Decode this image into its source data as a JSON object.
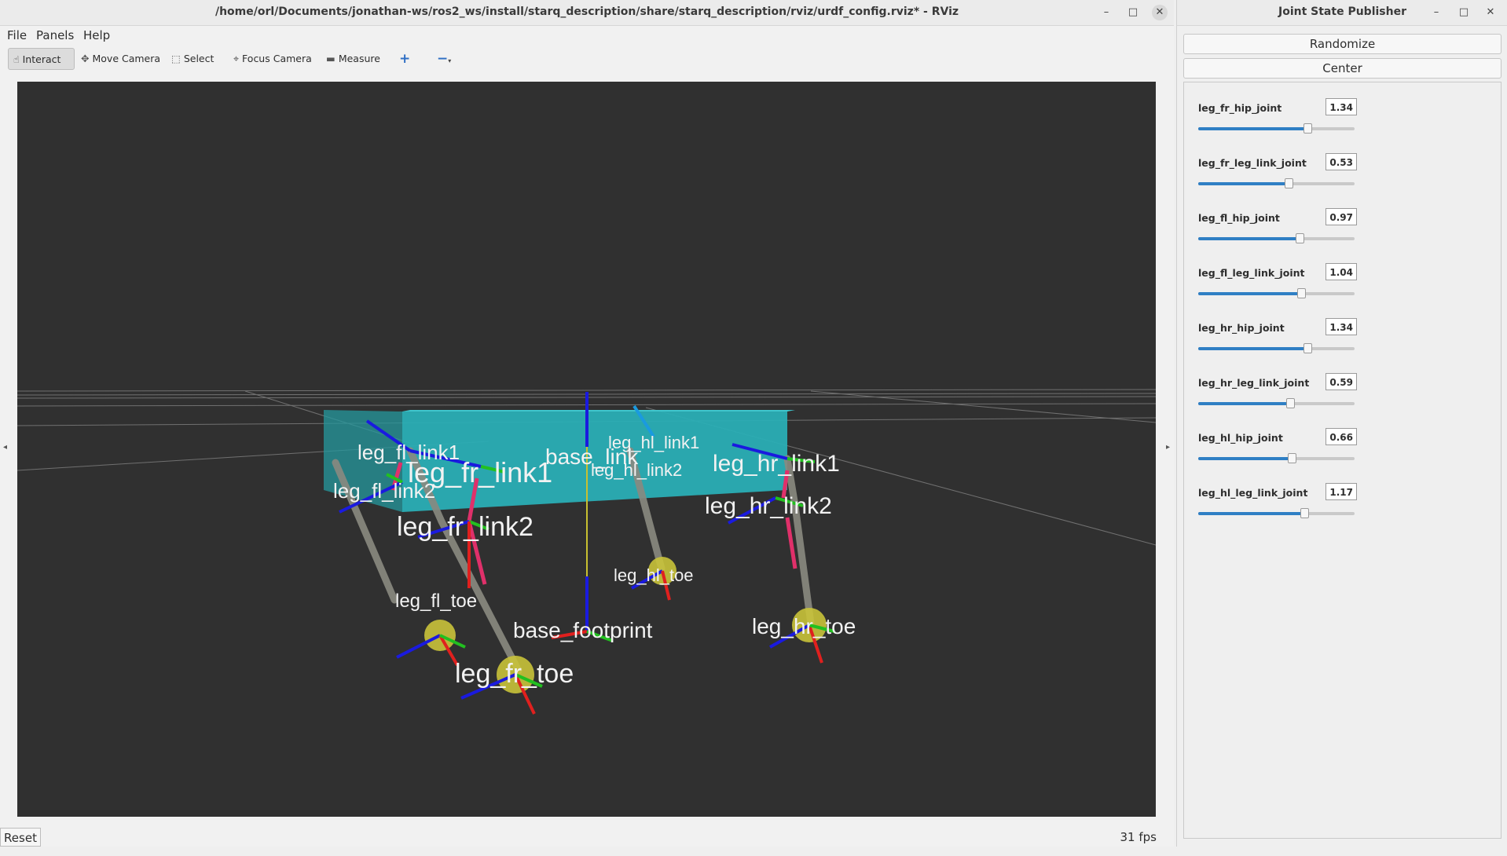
{
  "rviz": {
    "title": "/home/orl/Documents/jonathan-ws/ros2_ws/install/starq_description/share/starq_description/rviz/urdf_config.rviz* - RViz",
    "menu": [
      "File",
      "Panels",
      "Help"
    ],
    "toolbar": {
      "interact": "Interact",
      "move_camera": "Move Camera",
      "select": "Select",
      "focus_camera": "Focus Camera",
      "measure": "Measure",
      "add_icon": "plus-icon",
      "remove_icon": "minus-icon"
    },
    "frame_labels": {
      "leg_fr_link1_a": "leg_fr_link1",
      "leg_fl_link1": "leg_fl_link1",
      "base_link": "base_link",
      "leg_hl_link1": "leg_hl_link1",
      "leg_hl_link2": "leg_hl_link2",
      "leg_hr_link1": "leg_hr_link1",
      "leg_fl_link2": "leg_fl_link2",
      "leg_fr_link2": "leg_fr_link2",
      "leg_hr_link2": "leg_hr_link2",
      "leg_fl_toe": "leg_fl_toe",
      "leg_hl_toe": "leg_hl_toe",
      "base_footprint": "base_footprint",
      "leg_hr_toe": "leg_hr_toe",
      "leg_fr_toe": "leg_fr_toe"
    },
    "status": {
      "reset_label": "Reset",
      "fps": "31 fps"
    },
    "colors": {
      "viewport_bg": "#303030",
      "body": "#2bb8bf",
      "x_axis": "#e0201e",
      "y_axis": "#22c020",
      "z_axis": "#1a1adf"
    }
  },
  "jsp": {
    "title": "Joint State Publisher",
    "randomize_label": "Randomize",
    "center_label": "Center",
    "joints": [
      {
        "name": "leg_fr_hip_joint",
        "value": "1.34",
        "fraction": 0.7
      },
      {
        "name": "leg_fr_leg_link_joint",
        "value": "0.53",
        "fraction": 0.58
      },
      {
        "name": "leg_fl_hip_joint",
        "value": "0.97",
        "fraction": 0.65
      },
      {
        "name": "leg_fl_leg_link_joint",
        "value": "1.04",
        "fraction": 0.66
      },
      {
        "name": "leg_hr_hip_joint",
        "value": "1.34",
        "fraction": 0.7
      },
      {
        "name": "leg_hr_leg_link_joint",
        "value": "0.59",
        "fraction": 0.59
      },
      {
        "name": "leg_hl_hip_joint",
        "value": "0.66",
        "fraction": 0.6
      },
      {
        "name": "leg_hl_leg_link_joint",
        "value": "1.17",
        "fraction": 0.68
      }
    ]
  }
}
